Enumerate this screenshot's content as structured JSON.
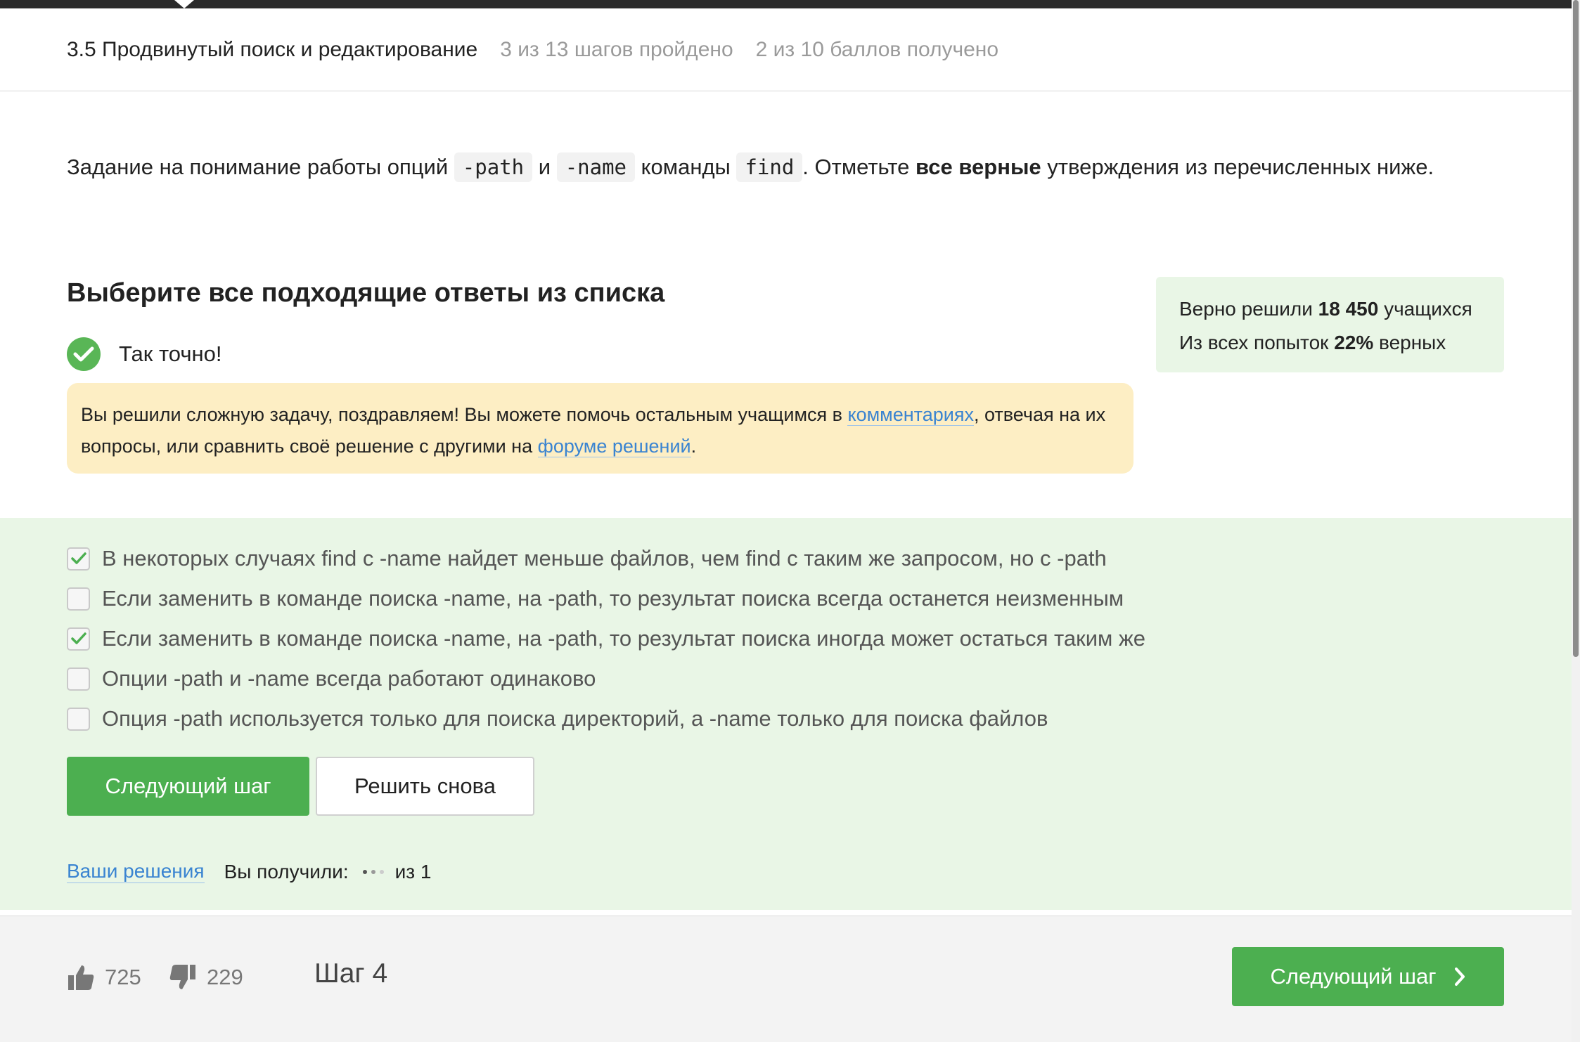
{
  "header": {
    "lesson_title": "3.5 Продвинутый поиск и редактирование",
    "steps_progress": "3 из 13 шагов пройдено",
    "points_progress": "2 из 10 баллов  получено"
  },
  "task": {
    "part1": "Задание на понимание работы опций",
    "code1": "-path",
    "part2": "и",
    "code2": "-name",
    "part3": "команды",
    "code3": "find",
    "part4": ". Отметьте",
    "bold": "все верные",
    "part5": "утверждения из перечисленных ниже."
  },
  "quiz": {
    "title": "Выберите все подходящие ответы из списка",
    "result_text": "Так точно!",
    "notice": {
      "text1": "Вы решили сложную задачу, поздравляем! Вы можете помочь остальным учащимся в",
      "link1": "комментариях",
      "text2": ", отвечая на их вопросы, или сравнить своё решение с другими на",
      "link2": "форуме решений",
      "text3": "."
    },
    "options": [
      {
        "label": "В некоторых случаях find c -name найдет меньше файлов, чем find с таким же запросом, но с -path",
        "checked": true
      },
      {
        "label": "Если заменить в команде поиска -name, на -path, то результат поиска всегда останется неизменным",
        "checked": false
      },
      {
        "label": "Если заменить в команде поиска -name, на -path, то результат поиска иногда может остаться таким же",
        "checked": true
      },
      {
        "label": "Опции -path и -name всегда работают одинаково",
        "checked": false
      },
      {
        "label": "Опция -path используется только для поиска директорий, а -name только для поиска файлов",
        "checked": false
      }
    ],
    "next_button": "Следующий шаг",
    "retry_button": "Решить снова",
    "your_solutions_link": "Ваши решения",
    "received_label": "Вы получили:",
    "of_total": "из 1"
  },
  "stats": {
    "solved_prefix": "Верно решили",
    "solved_count": "18 450",
    "solved_suffix": "учащихся",
    "attempts_prefix": "Из всех попыток",
    "attempts_percent": "22%",
    "attempts_suffix": "верных"
  },
  "footer": {
    "likes": "725",
    "dislikes": "229",
    "step_label": "Шаг 4",
    "next_button": "Следующий шаг"
  },
  "colors": {
    "accent_green": "#4caf50",
    "success_bg": "#e9f6e6",
    "notice_bg": "#fdeec4",
    "link_blue": "#3a84d1"
  }
}
